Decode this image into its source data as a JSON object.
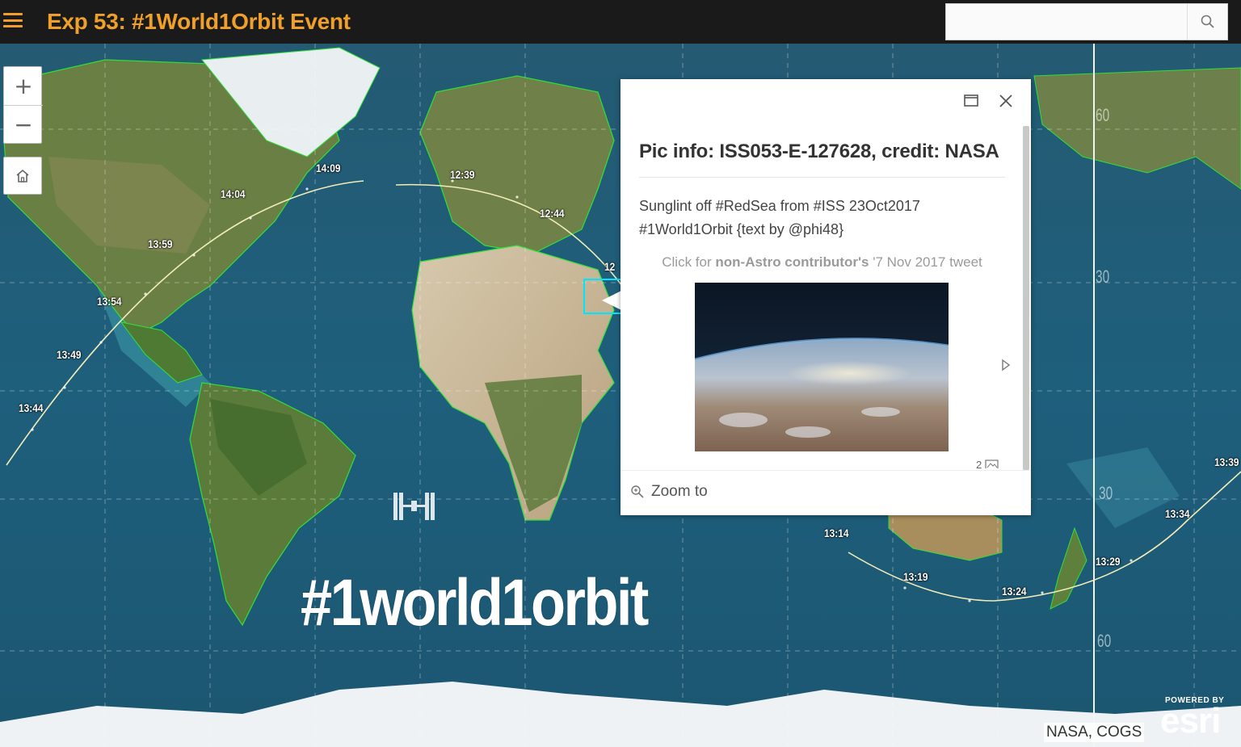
{
  "header": {
    "menu_icon": "hamburger-menu-icon",
    "title": "Exp 53: #1World1Orbit Event",
    "title_color": "#f0a02a",
    "background": "#1a1a1a",
    "search": {
      "placeholder": "",
      "value": "",
      "icon": "search-icon"
    }
  },
  "map_controls": {
    "zoom_in_symbol": "+",
    "zoom_out_symbol": "−",
    "home_icon": "home-icon"
  },
  "popup": {
    "title": "Pic info: ISS053-E-127628, credit: NASA",
    "description_line1": "Sunglint off #RedSea from #ISS 23Oct2017",
    "description_line2": "#1World1Orbit {text by @phi48}",
    "link_prefix": "Click for ",
    "link_bold": "non-Astro contributor's",
    "link_suffix": " '7 Nov 2017 tweet",
    "media_count": "2",
    "zoom_label": "Zoom to",
    "icons": [
      "maximize-icon",
      "close-icon",
      "next-media-icon",
      "zoom-to-icon",
      "media-icon"
    ]
  },
  "orbit_times": {
    "t1409": "14:09",
    "t1404": "14:04",
    "t1359": "13:59",
    "t1354": "13:54",
    "t1349": "13:49",
    "t1344": "13:44",
    "t1239": "12:39",
    "t1244": "12:44",
    "t12": "12",
    "t1314": "13:14",
    "t1319": "13:19",
    "t1324": "13:24",
    "t1329": "13:29",
    "t1334": "13:34",
    "t1339": "13:39"
  },
  "lat_labels": {
    "l60n": "60",
    "l30n": "30",
    "l30s": "30",
    "l60s": "60"
  },
  "overlay": {
    "hashtag": "#1world1orbit"
  },
  "footer": {
    "attribution": "NASA, COGS",
    "esri_powered": "POWERED BY",
    "esri_word": "esri"
  },
  "colors": {
    "ocean": "#1f5d77",
    "land": "#5d7a3c",
    "borders": "#2fe03a",
    "orbit_track": "#f2ecb8"
  }
}
